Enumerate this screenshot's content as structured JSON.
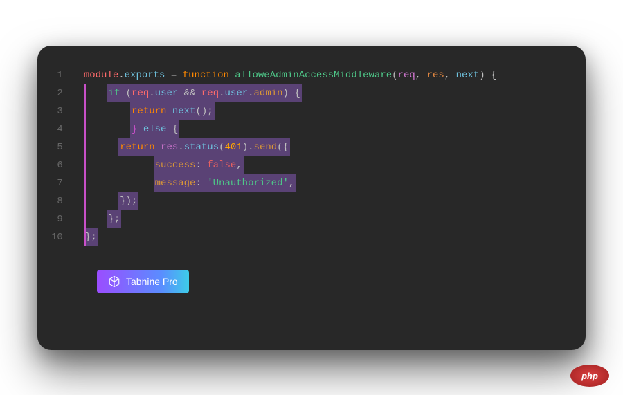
{
  "lineNumbers": [
    "1",
    "2",
    "3",
    "4",
    "5",
    "6",
    "7",
    "8",
    "9",
    "10"
  ],
  "code": {
    "line1": {
      "module": "module",
      "dot1": ".",
      "exports": "exports",
      "eq": " = ",
      "function": "function",
      "sp": " ",
      "fname": "alloweAdminAccessMiddleware",
      "open": "(",
      "req": "req",
      "c1": ", ",
      "res": "res",
      "c2": ", ",
      "next": "next",
      "close": ") {"
    },
    "line2": {
      "indent": "    ",
      "if": "if",
      "open": " (",
      "req1": "req",
      "dot1": ".",
      "user1": "user",
      "and": " && ",
      "req2": "req",
      "dot2": ".",
      "user2": "user",
      "dot3": ".",
      "admin": "admin",
      "close": ") {"
    },
    "line3": {
      "indent": "        ",
      "return": "return",
      "sp": " ",
      "next": "next",
      "call": "();"
    },
    "line4": {
      "indent": "        ",
      "brace": "} ",
      "else": "else",
      "open": " {"
    },
    "line5": {
      "indent": "      ",
      "return": "return",
      "sp": " ",
      "res": "res",
      "dot1": ".",
      "status": "status",
      "open1": "(",
      "num": "401",
      "close1": ")",
      "dot2": ".",
      "send": "send",
      "open2": "({"
    },
    "line6": {
      "indent": "            ",
      "prop": "success",
      "colon": ": ",
      "val": "false",
      "comma": ","
    },
    "line7": {
      "indent": "            ",
      "prop": "message",
      "colon": ": ",
      "val": "'Unauthorized'",
      "comma": ","
    },
    "line8": {
      "indent": "      ",
      "close": "});"
    },
    "line9": {
      "indent": "    ",
      "close": "};"
    },
    "line10": {
      "close": "};"
    }
  },
  "badge": {
    "label": "Tabnine Pro"
  },
  "watermark": {
    "text": "php"
  }
}
